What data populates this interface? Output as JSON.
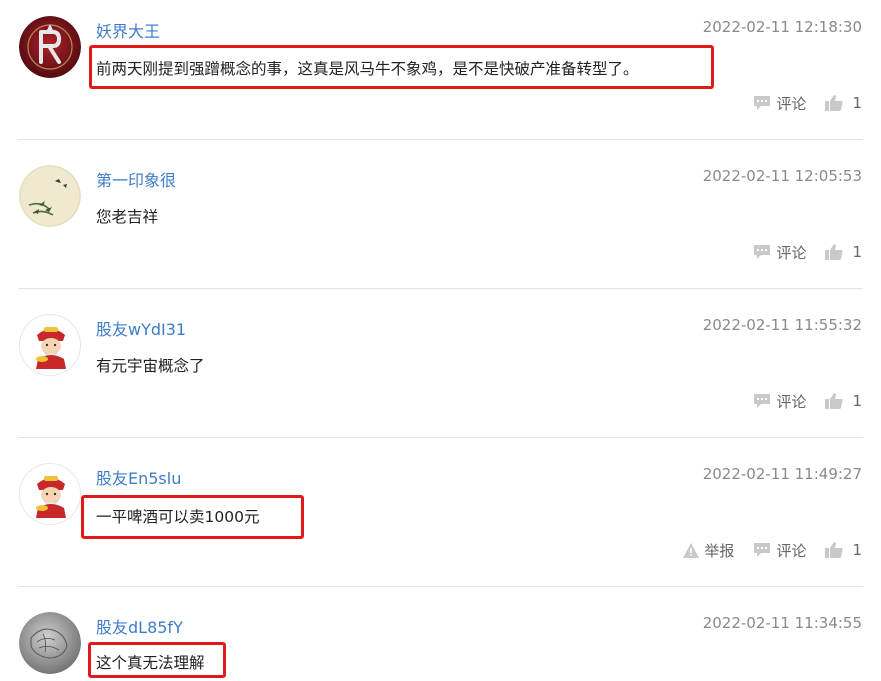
{
  "actions": {
    "comment_label": "评论",
    "report_label": "举报"
  },
  "colors": {
    "username": "#3f7cc8",
    "highlight_box": "#e0191c",
    "timestamp": "#8a8a8a"
  },
  "comments": [
    {
      "avatar": "rockets-logo-avatar",
      "username": "妖界大王",
      "time": "2022-02-11 12:18:30",
      "text": "前两天刚提到强蹭概念的事，这真是风马牛不象鸡，是不是快破产准备转型了。",
      "likes": "1",
      "highlighted": true,
      "show_report": false
    },
    {
      "avatar": "bamboo-painting-avatar",
      "username": "第一印象很",
      "time": "2022-02-11 12:05:53",
      "text": "您老吉祥",
      "likes": "1",
      "highlighted": false,
      "show_report": false
    },
    {
      "avatar": "fortune-god-avatar",
      "username": "股友wYdI31",
      "time": "2022-02-11 11:55:32",
      "text": "有元宇宙概念了",
      "likes": "1",
      "highlighted": false,
      "show_report": false
    },
    {
      "avatar": "fortune-god-avatar",
      "username": "股友En5slu",
      "time": "2022-02-11 11:49:27",
      "text": "一平啤酒可以卖1000元",
      "likes": "1",
      "highlighted": true,
      "show_report": true
    },
    {
      "avatar": "stone-texture-avatar",
      "username": "股友dL85fY",
      "time": "2022-02-11 11:34:55",
      "text": "这个真无法理解",
      "likes": "",
      "highlighted": true,
      "show_report": false
    }
  ]
}
